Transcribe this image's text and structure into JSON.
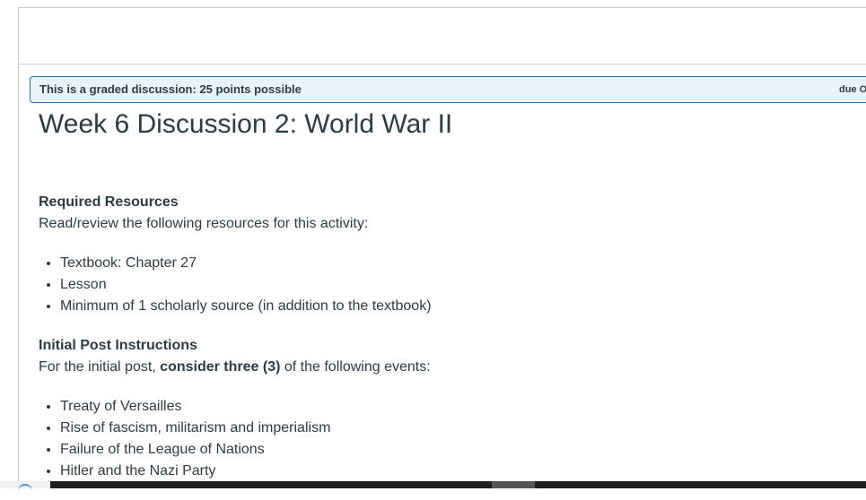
{
  "banner": {
    "text": "This is a graded discussion: 25 points possible",
    "due": "due O"
  },
  "title": "Week 6 Discussion 2: World War II",
  "required_resources": {
    "heading": "Required Resources",
    "intro": "Read/review the following resources for this activity:",
    "items": [
      "Textbook: Chapter 27",
      "Lesson",
      "Minimum of 1 scholarly source (in addition to the textbook)"
    ]
  },
  "initial_post": {
    "heading": "Initial Post Instructions",
    "intro_prefix": "For the initial post, ",
    "intro_bold": "consider three (3)",
    "intro_suffix": " of the following events:",
    "items": [
      "Treaty of Versailles",
      "Rise of fascism, militarism and imperialism",
      "Failure of the League of Nations",
      "Hitler and the Nazi Party"
    ]
  },
  "colors": {
    "banner_border": "#1d72b3",
    "banner_bg": "#eaf3f9",
    "text": "#2d3b45"
  }
}
